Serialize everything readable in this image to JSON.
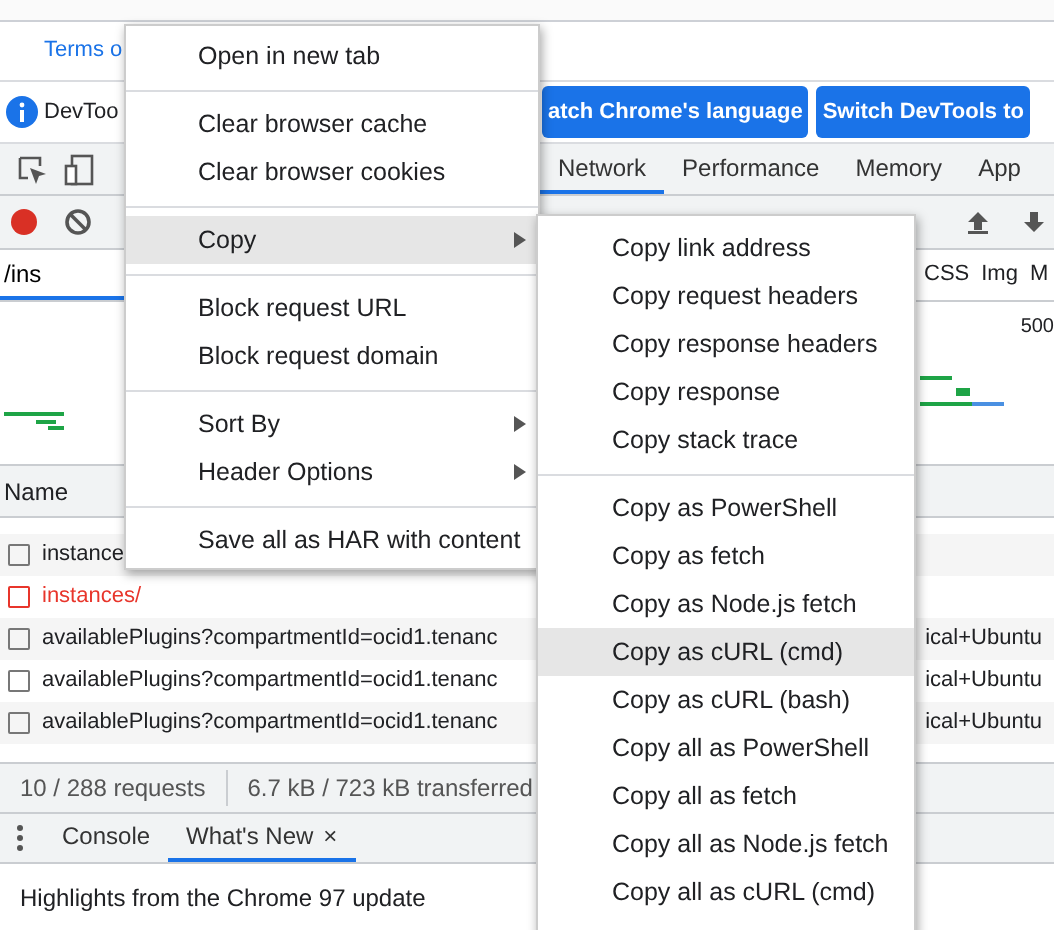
{
  "page": {
    "link": "Terms o"
  },
  "infobar": {
    "text": "DevToo",
    "buttons": [
      "atch Chrome's language",
      "Switch DevTools to"
    ]
  },
  "tabs": [
    {
      "label": "Network",
      "selected": true
    },
    {
      "label": "Performance",
      "selected": false
    },
    {
      "label": "Memory",
      "selected": false
    },
    {
      "label": "App",
      "selected": false
    }
  ],
  "filter": {
    "value": "/ins"
  },
  "type_filters": [
    "CSS",
    "Img",
    "M"
  ],
  "overview": {
    "tick": "500"
  },
  "table": {
    "columns": [
      "Name"
    ],
    "rows": [
      {
        "name": "instance",
        "error": false
      },
      {
        "name": "instances/",
        "error": true
      },
      {
        "name": "availablePlugins?compartmentId=ocid1.tenanc",
        "column_2": "ical+Ubuntu",
        "error": false
      },
      {
        "name": "availablePlugins?compartmentId=ocid1.tenanc",
        "column_2": "ical+Ubuntu",
        "error": false
      },
      {
        "name": "availablePlugins?compartmentId=ocid1.tenanc",
        "column_2": "ical+Ubuntu",
        "error": false
      }
    ]
  },
  "status_bar": [
    "10 / 288 requests",
    "6.7 kB / 723 kB transferred"
  ],
  "drawer": {
    "tabs": [
      {
        "label": "Console",
        "selected": false
      },
      {
        "label": "What's New",
        "selected": true,
        "close": "×"
      }
    ],
    "text": "Highlights from the Chrome 97 update"
  },
  "context_menu": {
    "groups": [
      [
        {
          "label": "Open in new tab",
          "submenu": false,
          "selected": false
        }
      ],
      [
        {
          "label": "Clear browser cache",
          "submenu": false,
          "selected": false
        },
        {
          "label": "Clear browser cookies",
          "submenu": false,
          "selected": false
        }
      ],
      [
        {
          "label": "Copy",
          "submenu": true,
          "selected": true
        }
      ],
      [
        {
          "label": "Block request URL",
          "submenu": false,
          "selected": false
        },
        {
          "label": "Block request domain",
          "submenu": false,
          "selected": false
        }
      ],
      [
        {
          "label": "Sort By",
          "submenu": true,
          "selected": false
        },
        {
          "label": "Header Options",
          "submenu": true,
          "selected": false
        }
      ],
      [
        {
          "label": "Save all as HAR with content",
          "submenu": false,
          "selected": false
        }
      ]
    ]
  },
  "copy_submenu": {
    "groups": [
      [
        {
          "label": "Copy link address",
          "selected": false
        },
        {
          "label": "Copy request headers",
          "selected": false
        },
        {
          "label": "Copy response headers",
          "selected": false
        },
        {
          "label": "Copy response",
          "selected": false
        },
        {
          "label": "Copy stack trace",
          "selected": false
        }
      ],
      [
        {
          "label": "Copy as PowerShell",
          "selected": false
        },
        {
          "label": "Copy as fetch",
          "selected": false
        },
        {
          "label": "Copy as Node.js fetch",
          "selected": false
        },
        {
          "label": "Copy as cURL (cmd)",
          "selected": true
        },
        {
          "label": "Copy as cURL (bash)",
          "selected": false
        },
        {
          "label": "Copy all as PowerShell",
          "selected": false
        },
        {
          "label": "Copy all as fetch",
          "selected": false
        },
        {
          "label": "Copy all as Node.js fetch",
          "selected": false
        },
        {
          "label": "Copy all as cURL (cmd)",
          "selected": false
        }
      ]
    ]
  }
}
